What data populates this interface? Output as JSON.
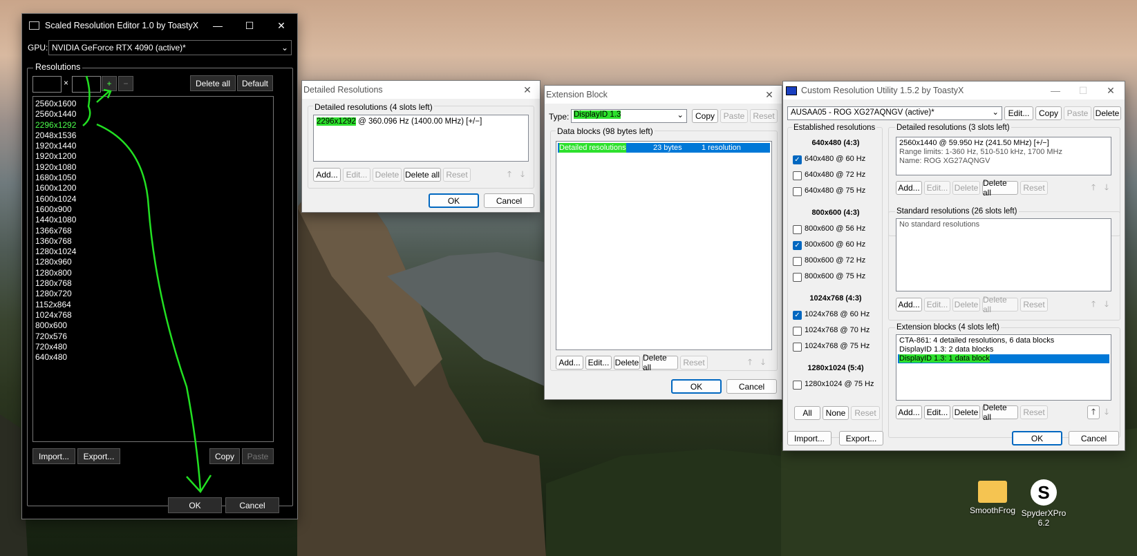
{
  "sre": {
    "title": "Scaled Resolution Editor 1.0 by ToastyX",
    "gpu_label": "GPU:",
    "gpu_value": "NVIDIA GeForce RTX 4090 (active)*",
    "group_label": "Resolutions",
    "times": "×",
    "plus": "+",
    "minus": "−",
    "delete_all": "Delete all",
    "default": "Default",
    "resolutions": [
      "2560x1600",
      "2560x1440",
      "2296x1292",
      "2048x1536",
      "1920x1440",
      "1920x1200",
      "1920x1080",
      "1680x1050",
      "1600x1200",
      "1600x1024",
      "1600x900",
      "1440x1080",
      "1366x768",
      "1360x768",
      "1280x1024",
      "1280x960",
      "1280x800",
      "1280x768",
      "1280x720",
      "1152x864",
      "1024x768",
      "800x600",
      "720x576",
      "720x480",
      "640x480"
    ],
    "import": "Import...",
    "export": "Export...",
    "copy": "Copy",
    "paste": "Paste",
    "ok": "OK",
    "cancel": "Cancel"
  },
  "detailed": {
    "title": "Detailed Resolutions",
    "group_label": "Detailed resolutions (4 slots left)",
    "entry_res": "2296x1292",
    "entry_rest": " @ 360.096 Hz (1400.00 MHz) [+/−]",
    "add": "Add...",
    "edit": "Edit...",
    "delete": "Delete",
    "delete_all": "Delete all",
    "reset": "Reset",
    "ok": "OK",
    "cancel": "Cancel"
  },
  "extension": {
    "title": "Extension Block",
    "type_label": "Type:",
    "type_value": "DisplayID 1.3",
    "copy": "Copy",
    "paste": "Paste",
    "reset": "Reset",
    "group_label": "Data blocks (98 bytes left)",
    "row_name": "Detailed resolutions",
    "row_size": "23 bytes",
    "row_count": "1 resolution",
    "add": "Add...",
    "edit": "Edit...",
    "delete": "Delete",
    "delete_all": "Delete all",
    "reset2": "Reset",
    "ok": "OK",
    "cancel": "Cancel"
  },
  "cru": {
    "title": "Custom Resolution Utility 1.5.2 by ToastyX",
    "monitor": "AUSAA05 - ROG XG27AQNGV (active)*",
    "edit": "Edit...",
    "copy": "Copy",
    "paste": "Paste",
    "delete": "Delete",
    "established_label": "Established resolutions",
    "groups": [
      {
        "header": "640x480 (4:3)",
        "items": [
          {
            "label": "640x480 @ 60 Hz",
            "checked": true
          },
          {
            "label": "640x480 @ 72 Hz",
            "checked": false
          },
          {
            "label": "640x480 @ 75 Hz",
            "checked": false
          }
        ]
      },
      {
        "header": "800x600 (4:3)",
        "items": [
          {
            "label": "800x600 @ 56 Hz",
            "checked": false
          },
          {
            "label": "800x600 @ 60 Hz",
            "checked": true
          },
          {
            "label": "800x600 @ 72 Hz",
            "checked": false
          },
          {
            "label": "800x600 @ 75 Hz",
            "checked": false
          }
        ]
      },
      {
        "header": "1024x768 (4:3)",
        "items": [
          {
            "label": "1024x768 @ 60 Hz",
            "checked": true
          },
          {
            "label": "1024x768 @ 70 Hz",
            "checked": false
          },
          {
            "label": "1024x768 @ 75 Hz",
            "checked": false
          }
        ]
      },
      {
        "header": "1280x1024 (5:4)",
        "items": [
          {
            "label": "1280x1024 @ 75 Hz",
            "checked": false
          }
        ]
      }
    ],
    "all": "All",
    "none": "None",
    "reset": "Reset",
    "detailed_label": "Detailed resolutions (3 slots left)",
    "detailed_line1": "2560x1440 @ 59.950 Hz (241.50 MHz) [+/−]",
    "detailed_line2": "Range limits: 1-360 Hz, 510-510 kHz, 1700 MHz",
    "detailed_line3": "Name: ROG XG27AQNGV",
    "standard_label": "Standard resolutions (26 slots left)",
    "standard_empty": "No standard resolutions",
    "ext_label": "Extension blocks (4 slots left)",
    "ext_items": [
      "CTA-861: 4 detailed resolutions, 6 data blocks",
      "DisplayID 1.3: 2 data blocks",
      "DisplayID 1.3: 1 data block"
    ],
    "add": "Add...",
    "edit2": "Edit...",
    "delete2": "Delete",
    "delete_all": "Delete all",
    "reset2": "Reset",
    "import": "Import...",
    "export": "Export...",
    "ok": "OK",
    "cancel": "Cancel"
  },
  "desktop": {
    "icon1": "SmoothFrog",
    "icon2_line1": "SpyderXPro",
    "icon2_line2": "6.2"
  },
  "colors": {
    "accent": "#0067c0",
    "highlight": "#2de02d",
    "selection": "#0078d7"
  }
}
